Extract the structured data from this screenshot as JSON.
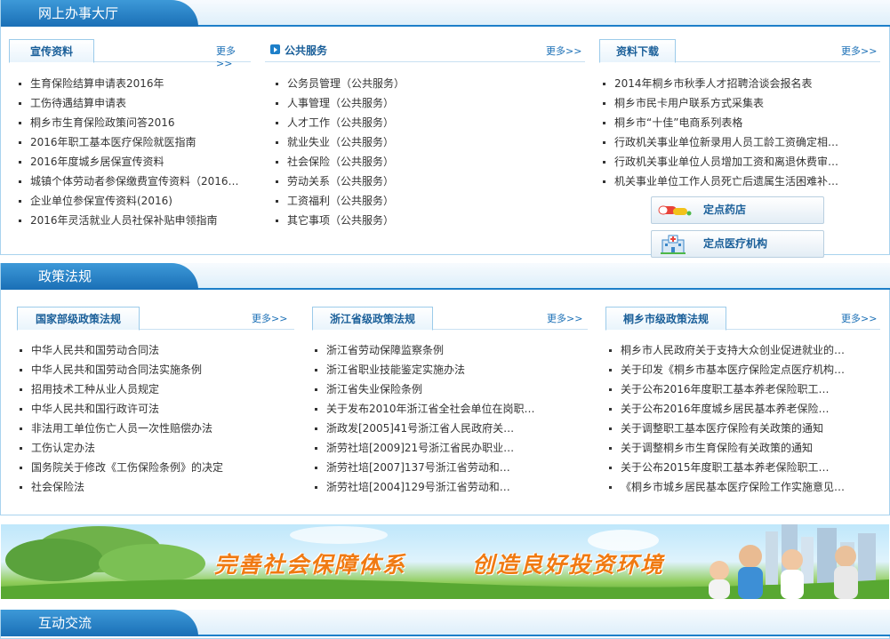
{
  "sections": {
    "online": {
      "title": "网上办事大厅"
    },
    "policy": {
      "title": "政策法规"
    },
    "interact": {
      "title": "互动交流"
    }
  },
  "more_label": "更多>>",
  "online": {
    "publicity": {
      "title": "宣传资料",
      "items": [
        "生育保险结算申请表2016年",
        "工伤待遇结算申请表",
        "桐乡市生育保险政策问答2016",
        "2016年职工基本医疗保险就医指南",
        "2016年度城乡居保宣传资料",
        "城镇个体劳动者参保缴费宣传资料（2016…",
        "企业单位参保宣传资料(2016)",
        "2016年灵活就业人员社保补贴申领指南"
      ]
    },
    "public_service": {
      "title": "公共服务",
      "items": [
        "公务员管理（公共服务）",
        "人事管理（公共服务）",
        "人才工作（公共服务）",
        "就业失业（公共服务）",
        "社会保险（公共服务）",
        "劳动关系（公共服务）",
        "工资福利（公共服务）",
        "其它事项（公共服务）"
      ]
    },
    "downloads": {
      "title": "资料下载",
      "items": [
        "2014年桐乡市秋季人才招聘洽谈会报名表",
        "桐乡市民卡用户联系方式采集表",
        "桐乡市“十佳”电商系列表格",
        "行政机关事业单位新录用人员工龄工资确定相…",
        "行政机关事业单位人员增加工资和离退休费审…",
        "机关事业单位工作人员死亡后遗属生活困难补…"
      ]
    },
    "pharmacy_button": "定点药店",
    "medical_button": "定点医疗机构"
  },
  "policy": {
    "national": {
      "title": "国家部级政策法规",
      "items": [
        "中华人民共和国劳动合同法",
        "中华人民共和国劳动合同法实施条例",
        "招用技术工种从业人员规定",
        "中华人民共和国行政许可法",
        "非法用工单位伤亡人员一次性赔偿办法",
        "工伤认定办法",
        "国务院关于修改《工伤保险条例》的决定",
        "社会保险法"
      ]
    },
    "provincial": {
      "title": "浙江省级政策法规",
      "items": [
        "浙江省劳动保障监察条例",
        "浙江省职业技能鉴定实施办法",
        "浙江省失业保险条例",
        "关于发布2010年浙江省全社会单位在岗职…",
        "浙政发[2005]41号浙江省人民政府关…",
        "浙劳社培[2009]21号浙江省民办职业…",
        "浙劳社培[2007]137号浙江省劳动和…",
        "浙劳社培[2004]129号浙江省劳动和…"
      ]
    },
    "municipal": {
      "title": "桐乡市级政策法规",
      "items": [
        "桐乡市人民政府关于支持大众创业促进就业的…",
        "关于印发《桐乡市基本医疗保险定点医疗机构…",
        "关于公布2016年度职工基本养老保险职工…",
        "关于公布2016年度城乡居民基本养老保险…",
        "关于调整职工基本医疗保险有关政策的通知",
        "关于调整桐乡市生育保险有关政策的通知",
        "关于公布2015年度职工基本养老保险职工…",
        "《桐乡市城乡居民基本医疗保险工作实施意见…"
      ]
    }
  },
  "banner": {
    "slogan_left": "完善社会保障体系",
    "slogan_right": "创造良好投资环境"
  }
}
